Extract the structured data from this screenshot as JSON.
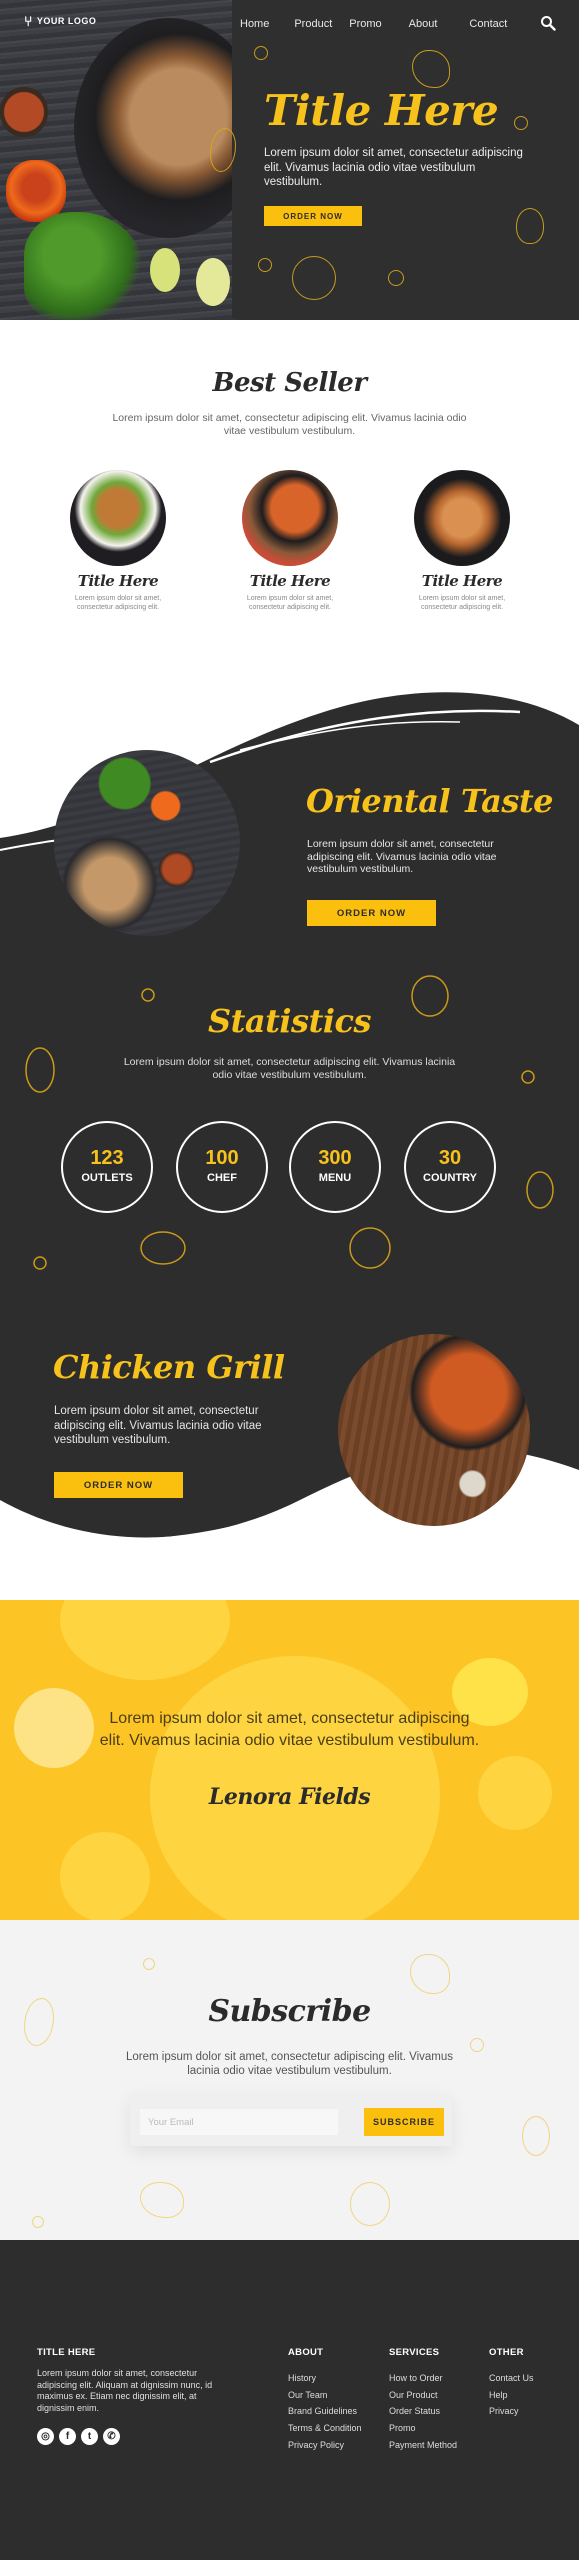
{
  "colors": {
    "accent": "#fbbf0e",
    "dark": "#2d2d2d",
    "quote_bg": "#fcc525",
    "light_bg": "#f3f3f3"
  },
  "hero": {
    "logo_text": "YOUR LOGO",
    "logo_icon": "fork-spoon-icon",
    "nav": [
      "Home",
      "Product",
      "Promo",
      "About",
      "Contact"
    ],
    "search_icon": "search-icon",
    "title": "Title Here",
    "text": "Lorem ipsum dolor sit amet, consectetur adipiscing elit. Vivamus lacinia odio vitae vestibulum vestibulum.",
    "button": "ORDER NOW"
  },
  "best_seller": {
    "title": "Best Seller",
    "text": "Lorem ipsum dolor sit amet, consectetur adipiscing elit. Vivamus lacinia odio vitae vestibulum vestibulum.",
    "items": [
      {
        "title": "Title Here",
        "text": "Lorem ipsum dolor sit amet, consectetur adipiscing elit."
      },
      {
        "title": "Title Here",
        "text": "Lorem ipsum dolor sit amet, consectetur adipiscing elit."
      },
      {
        "title": "Title Here",
        "text": "Lorem ipsum dolor sit amet, consectetur adipiscing elit."
      }
    ]
  },
  "oriental": {
    "title": "Oriental Taste",
    "text": "Lorem ipsum dolor sit amet, consectetur adipiscing elit. Vivamus lacinia odio vitae vestibulum vestibulum.",
    "button": "ORDER NOW"
  },
  "statistics": {
    "title": "Statistics",
    "text": "Lorem ipsum dolor sit amet, consectetur adipiscing elit. Vivamus lacinia odio vitae vestibulum vestibulum.",
    "items": [
      {
        "value": "123",
        "label": "OUTLETS"
      },
      {
        "value": "100",
        "label": "CHEF"
      },
      {
        "value": "300",
        "label": "MENU"
      },
      {
        "value": "30",
        "label": "COUNTRY"
      }
    ]
  },
  "chicken": {
    "title": "Chicken Grill",
    "text": "Lorem ipsum dolor sit amet, consectetur adipiscing elit. Vivamus lacinia odio vitae vestibulum vestibulum.",
    "button": "ORDER NOW"
  },
  "testimonial": {
    "quote": "Lorem ipsum dolor sit amet, consectetur adipiscing elit. Vivamus lacinia odio vitae vestibulum vestibulum.",
    "author": "Lenora Fields"
  },
  "subscribe": {
    "title": "Subscribe",
    "text": "Lorem ipsum dolor sit amet, consectetur adipiscing elit. Vivamus lacinia odio vitae vestibulum vestibulum.",
    "email_placeholder": "Your Email",
    "email_value": "",
    "button": "SUBSCRIBE"
  },
  "footer": {
    "title": "TITLE HERE",
    "text": "Lorem ipsum dolor sit amet, consectetur adipiscing elit. Aliquam at dignissim nunc, id maximus ex. Etiam nec dignissim elit, at dignissim enim.",
    "socials": [
      {
        "name": "instagram-icon",
        "glyph": "◎"
      },
      {
        "name": "facebook-icon",
        "glyph": "f"
      },
      {
        "name": "twitter-icon",
        "glyph": "t"
      },
      {
        "name": "whatsapp-icon",
        "glyph": "✆"
      }
    ],
    "columns": [
      {
        "title": "ABOUT",
        "links": [
          "History",
          "Our Team",
          "Brand Guidelines",
          "Terms & Condition",
          "Privacy Policy"
        ]
      },
      {
        "title": "SERVICES",
        "links": [
          "How to Order",
          "Our Product",
          "Order Status",
          "Promo",
          "Payment Method"
        ]
      },
      {
        "title": "OTHER",
        "links": [
          "Contact Us",
          "Help",
          "Privacy"
        ]
      }
    ]
  }
}
